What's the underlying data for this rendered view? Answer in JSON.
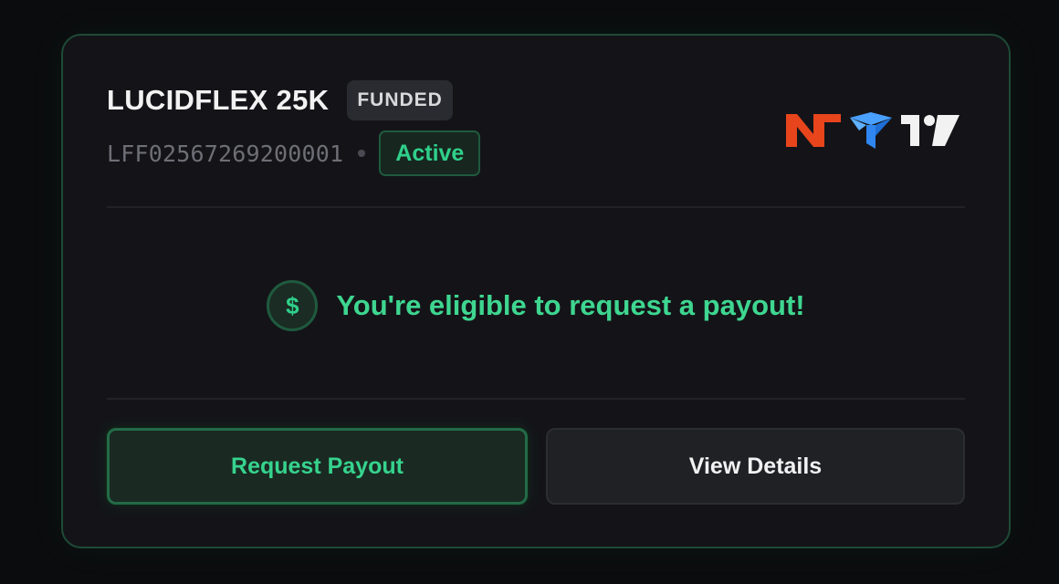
{
  "account": {
    "name": "LUCIDFLEX 25K",
    "tier_badge": "FUNDED",
    "id": "LFF02567269200001",
    "status": "Active"
  },
  "platforms": [
    {
      "icon": "ninjatrader-icon",
      "color": "#e8451c"
    },
    {
      "icon": "tradovate-icon",
      "color": "#2f86f0"
    },
    {
      "icon": "tradingview-icon",
      "color": "#f2f2f3"
    }
  ],
  "payout_notice": {
    "icon": "dollar-icon",
    "symbol": "$",
    "message": "You're eligible to request a payout!"
  },
  "actions": {
    "primary_label": "Request Payout",
    "secondary_label": "View Details"
  },
  "colors": {
    "accent": "#2fd08a",
    "card_border": "#1f4a36",
    "background": "#0b0c0e"
  }
}
